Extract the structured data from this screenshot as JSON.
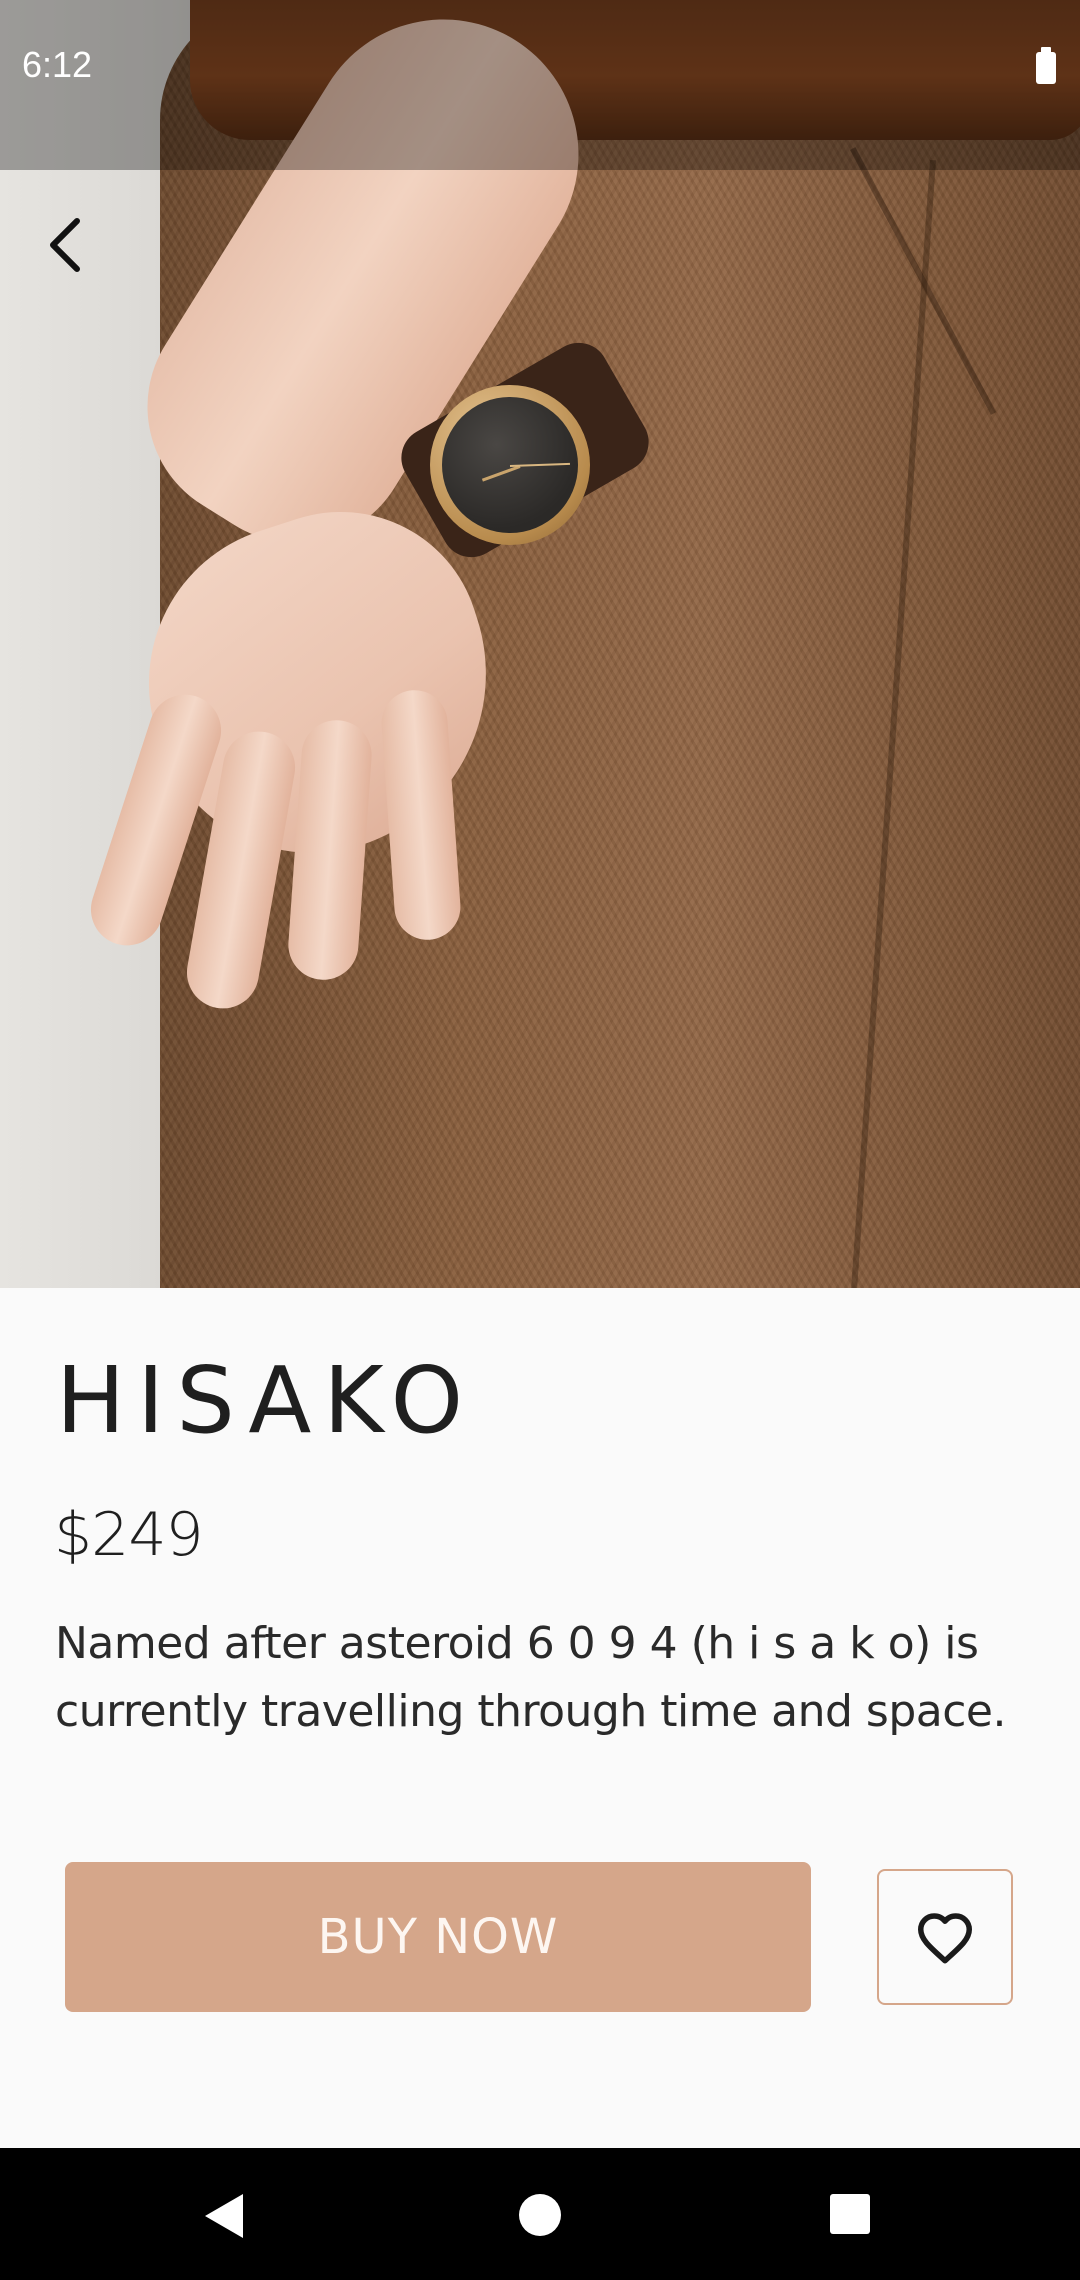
{
  "status_bar": {
    "time": "6:12",
    "battery_icon": "battery-full-icon"
  },
  "hero": {
    "image_alt": "Hand wearing a watch with a dark dial and brown leather strap, against brown herringbone trousers"
  },
  "toolbar": {
    "back_icon": "chevron-left-icon"
  },
  "product": {
    "name": "HISAKO",
    "price": "$249",
    "description": "Named after asteroid 6 0 9 4 (h i s a k o) is currently travelling through time and space."
  },
  "actions": {
    "buy_label": "BUY NOW",
    "favorite_icon": "heart-outline-icon"
  },
  "colors": {
    "accent": "#d5a68a",
    "text": "#1f1f1f",
    "background": "#fafafa"
  },
  "nav_bar": {
    "back_icon": "triangle-back-icon",
    "home_icon": "circle-home-icon",
    "recents_icon": "square-recents-icon"
  }
}
